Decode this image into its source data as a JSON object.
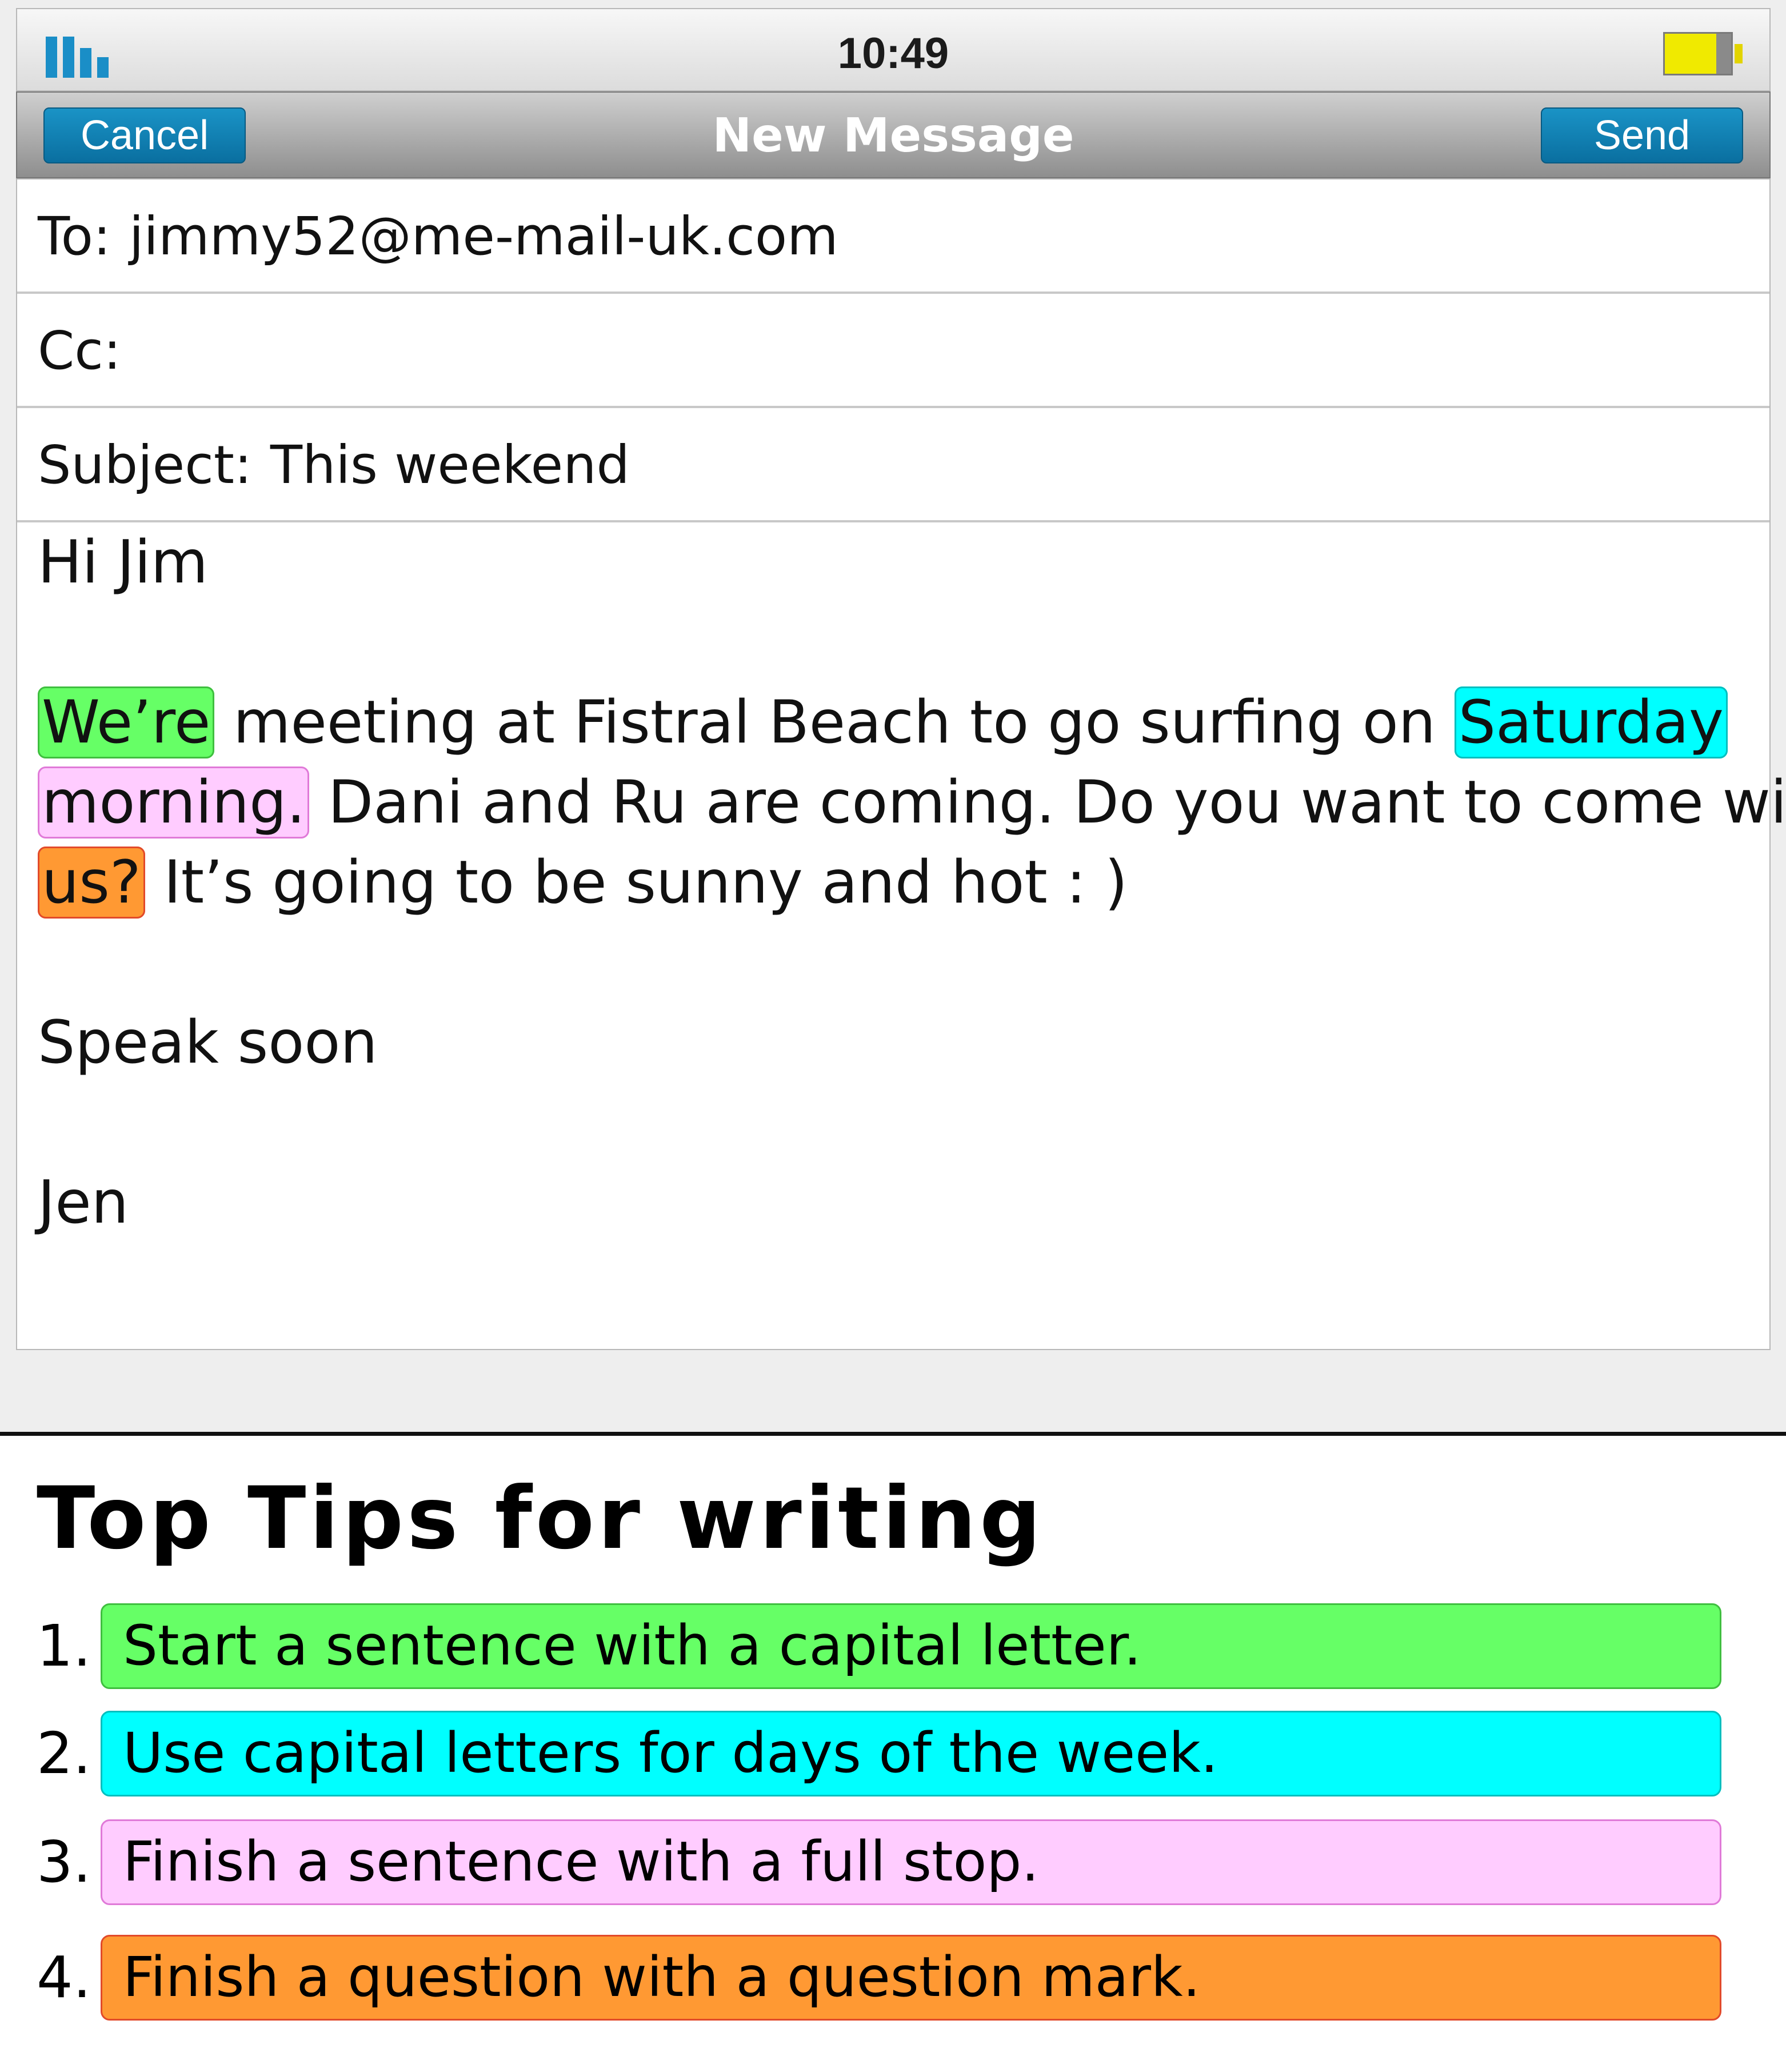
{
  "status_bar": {
    "time": "10:49",
    "battery_level": 0.78
  },
  "nav": {
    "cancel_label": "Cancel",
    "title": "New Message",
    "send_label": "Send"
  },
  "fields": {
    "to_label": "To:",
    "to_value": "jimmy52@me-mail-uk.com",
    "cc_label": "Cc:",
    "cc_value": "",
    "subject_label": "Subject:",
    "subject_value": "This weekend"
  },
  "body": {
    "greeting": "Hi Jim",
    "line1_hl": "We’re",
    "line1_text": " meeting at Fistral Beach to go surfing on ",
    "line1_hl2": "Saturday",
    "line2_hl": "morning.",
    "line2_text": " Dani and Ru are coming. Do you want to come with",
    "line3_hl": "us?",
    "line3_text": " It’s going to be sunny and hot : )",
    "closing": "Speak soon",
    "signature": "Jen"
  },
  "tips": {
    "title": "Top Tips for writing",
    "items": [
      {
        "num": "1.",
        "text": "Start a sentence with a capital letter.",
        "color": "#66ff66"
      },
      {
        "num": "2.",
        "text": "Use capital letters for days of the week.",
        "color": "#00ffff"
      },
      {
        "num": "3.",
        "text": "Finish a sentence with a full stop.",
        "color": "#ffccff"
      },
      {
        "num": "4.",
        "text": "Finish a question with a question mark.",
        "color": "#ff9933"
      }
    ]
  },
  "colors": {
    "accent_blue": "#0a7fb5",
    "green": "#66ff66",
    "cyan": "#00ffff",
    "pink": "#ffccff",
    "orange": "#ff9933"
  }
}
